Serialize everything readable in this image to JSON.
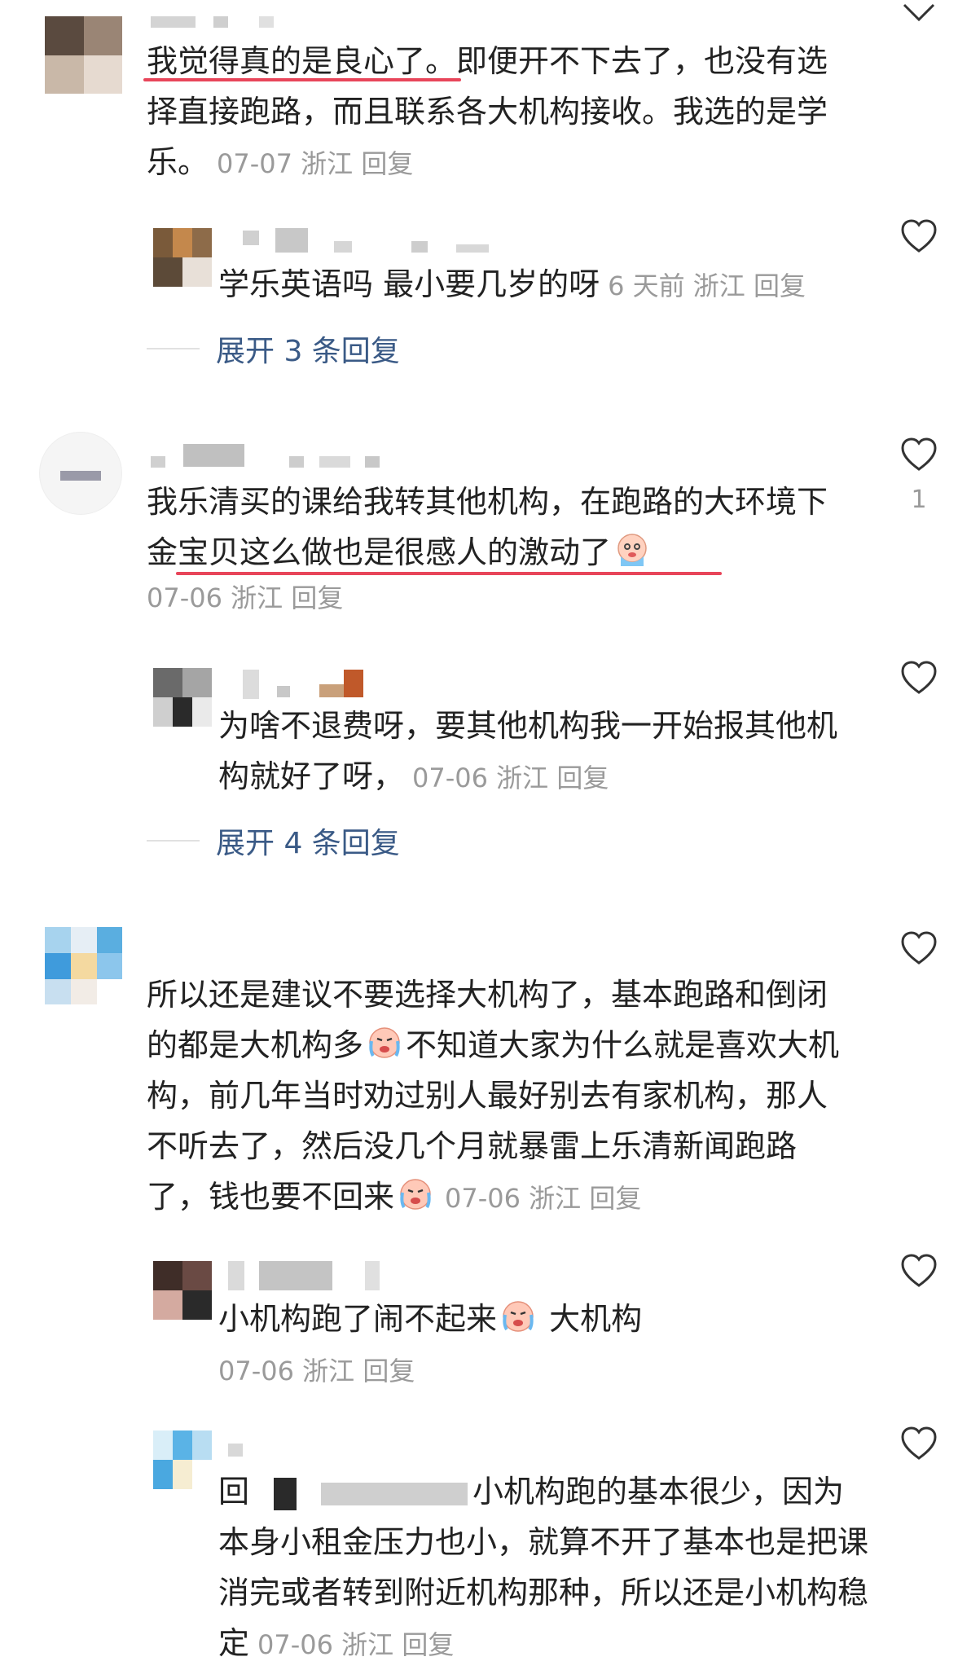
{
  "comments": [
    {
      "text_a": "我觉得真的是良心了。即便开不下去了，也没有选择直接跑路，而且联系各大机构接收。我选的是学乐。",
      "meta": "07-07 浙江 回复",
      "reply": {
        "text": "学乐英语吗 最小要几岁的呀",
        "meta": "6 天前 浙江 回复"
      },
      "expand": "展开 3 条回复"
    },
    {
      "text_a": "我乐清买的课给我转其他机构，在跑路的大环境下金宝贝这么做也是很感人的激动了",
      "meta": "07-06 浙江 回复",
      "like_count": "1",
      "reply": {
        "text": "为啥不退费呀，要其他机构我一开始报其他机构就好了呀，",
        "meta": "07-06 浙江 回复"
      },
      "expand": "展开 4 条回复"
    },
    {
      "text_a": "所以还是建议不要选择大机构了，基本跑路和倒闭的都是大机构多",
      "text_b": "不知道大家为什么就是喜欢大机构，前几年当时劝过别人最好别去有家机构，那人不听去了，然后没几个月就暴雷上乐清新闻跑路了，钱也要不回来",
      "meta": "07-06 浙江 回复",
      "reply1": {
        "text_a": "小机构跑了闹不起来",
        "text_b": " 大机构",
        "meta": "07-06 浙江 回复"
      },
      "reply2": {
        "prefix": "回",
        "text": "小机构跑的基本很少，因为本身小租金压力也小，就算不开了基本也是把课消完或者转到附近机构那种，所以还是小机构稳定",
        "meta": "07-06 浙江 回复"
      }
    }
  ],
  "icons": {
    "like": "heart-outline-icon",
    "collapse": "chevron-down-icon",
    "emoji": "crying-face-emoji"
  },
  "colors": {
    "underline": "#e8455a",
    "link": "#3a5a86",
    "meta": "#9a9a9a"
  }
}
